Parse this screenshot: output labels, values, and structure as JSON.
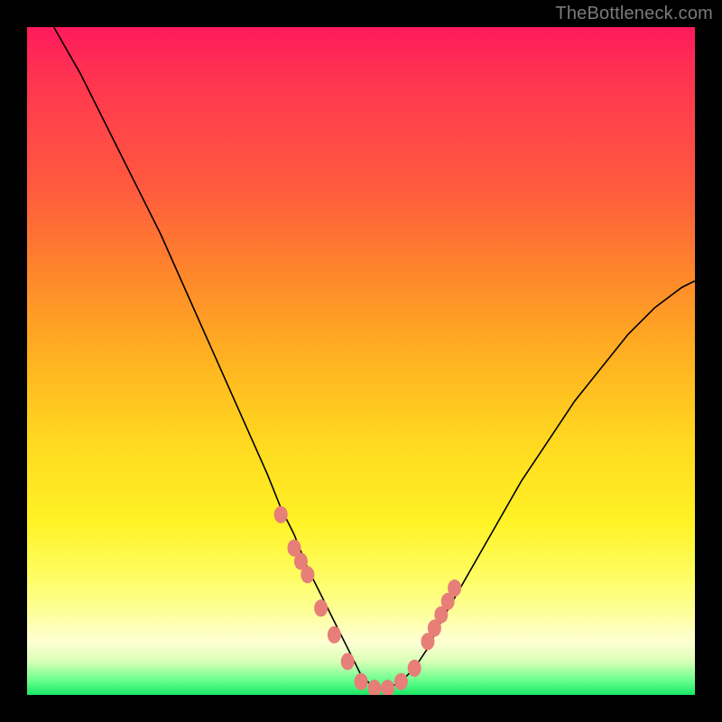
{
  "watermark": "TheBottleneck.com",
  "colors": {
    "frame": "#000000",
    "curve": "#000000",
    "points": "#e77e78",
    "gradient_top": "#ff1a5c",
    "gradient_bottom": "#18e664"
  },
  "chart_data": {
    "type": "line",
    "title": "",
    "xlabel": "",
    "ylabel": "",
    "xlim": [
      0,
      100
    ],
    "ylim": [
      0,
      100
    ],
    "note": "Axes are unlabeled. x is normalized 0–100 left→right across the plot; y is normalized 0–100 bottom→top. Curve is a V-shaped bottleneck profile with minimum near x≈52, y≈0.",
    "series": [
      {
        "name": "bottleneck-curve",
        "x": [
          4,
          8,
          12,
          16,
          20,
          24,
          28,
          32,
          36,
          38,
          40,
          42,
          44,
          46,
          48,
          50,
          52,
          54,
          56,
          58,
          60,
          62,
          66,
          70,
          74,
          78,
          82,
          86,
          90,
          94,
          98,
          100
        ],
        "y": [
          100,
          93,
          85,
          77,
          69,
          60,
          51,
          42,
          33,
          28,
          24,
          19,
          15,
          11,
          7,
          3,
          1,
          1,
          2,
          4,
          7,
          11,
          18,
          25,
          32,
          38,
          44,
          49,
          54,
          58,
          61,
          62
        ]
      }
    ],
    "highlight_points": {
      "name": "salmon-dots",
      "note": "Clustered markers on the curve near the trough and on both ascending sides.",
      "x": [
        38,
        40,
        41,
        42,
        44,
        46,
        48,
        50,
        52,
        54,
        56,
        58,
        60,
        61,
        62,
        63,
        64
      ],
      "y": [
        27,
        22,
        20,
        18,
        13,
        9,
        5,
        2,
        1,
        1,
        2,
        4,
        8,
        10,
        12,
        14,
        16
      ]
    }
  }
}
